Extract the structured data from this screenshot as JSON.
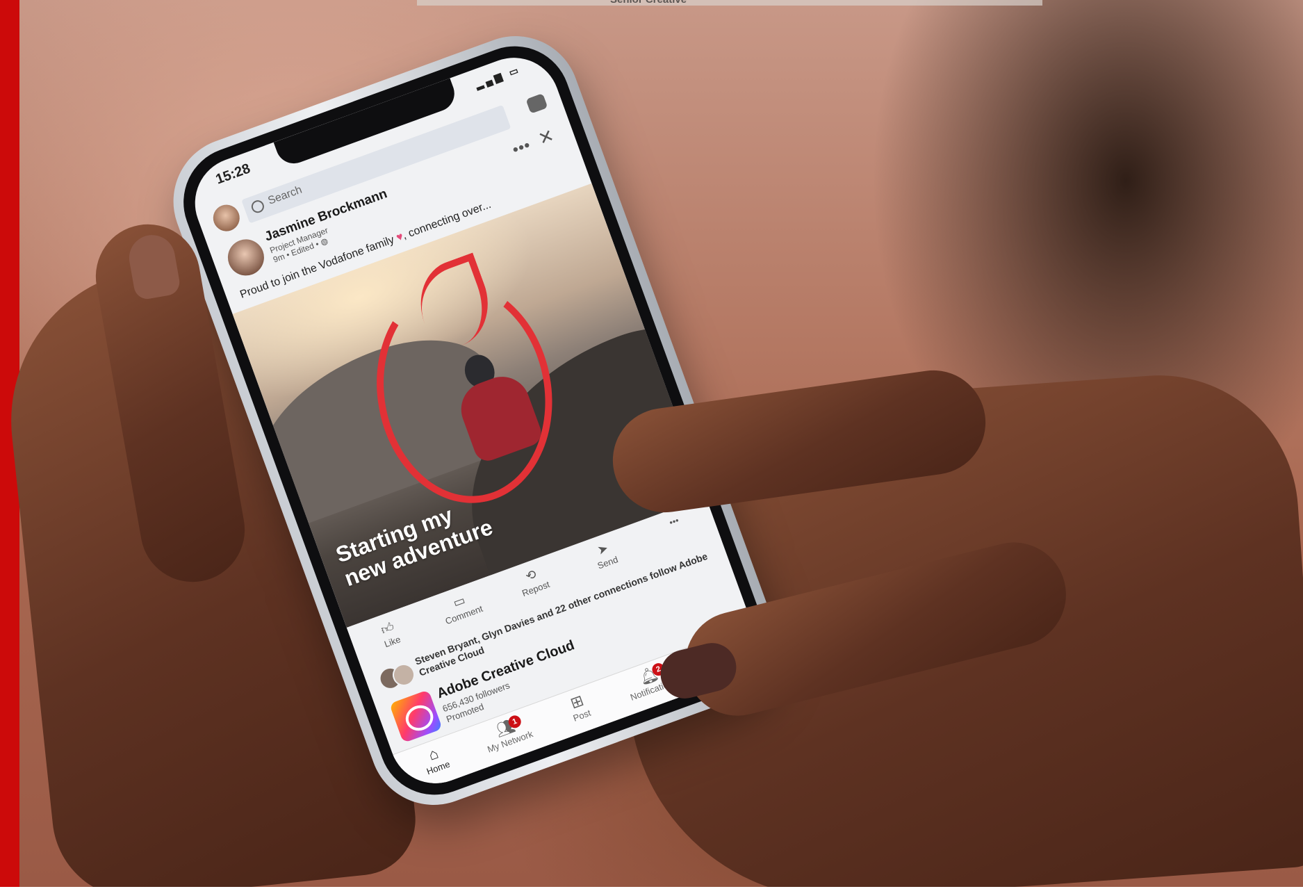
{
  "overlay": {
    "top_text": "Senior Creative"
  },
  "phone": {
    "status_time": "15:28",
    "search_placeholder": "Search",
    "post": {
      "author_name": "Jasmine Brockmann",
      "author_title": "Project Manager",
      "meta": "9m • Edited • ",
      "text": "Proud to join the Vodafone family ",
      "text_tail": ", connecting over...",
      "headline_line1": "Starting my",
      "headline_line2": "new adventure"
    },
    "actions": {
      "like": "Like",
      "comment": "Comment",
      "repost": "Repost",
      "send": "Send",
      "more": "•••"
    },
    "social_proof": "Steven Bryant, Glyn Davies and 22 other connections follow Adobe Creative Cloud",
    "promo": {
      "name": "Adobe Creative Cloud",
      "followers": "656,430 followers",
      "label": "Promoted"
    },
    "tabs": {
      "home": "Home",
      "network": "My Network",
      "network_badge": "1",
      "post": "Post",
      "notifications": "Notifications",
      "notifications_badge": "2",
      "jobs": ""
    }
  },
  "colors": {
    "brand_red": "#e60000",
    "side_bar": "#cc0a0a",
    "badge_red": "#cc1016"
  },
  "icons": {
    "search": "search-icon",
    "message": "message-icon",
    "more": "more-icon",
    "close": "close-icon",
    "like": "thumbs-up-icon",
    "comment": "comment-icon",
    "repost": "repost-icon",
    "send": "send-icon",
    "home": "home-icon",
    "network": "network-icon",
    "post": "plus-square-icon",
    "notifications": "bell-icon",
    "brand": "vodafone-logo-icon"
  }
}
